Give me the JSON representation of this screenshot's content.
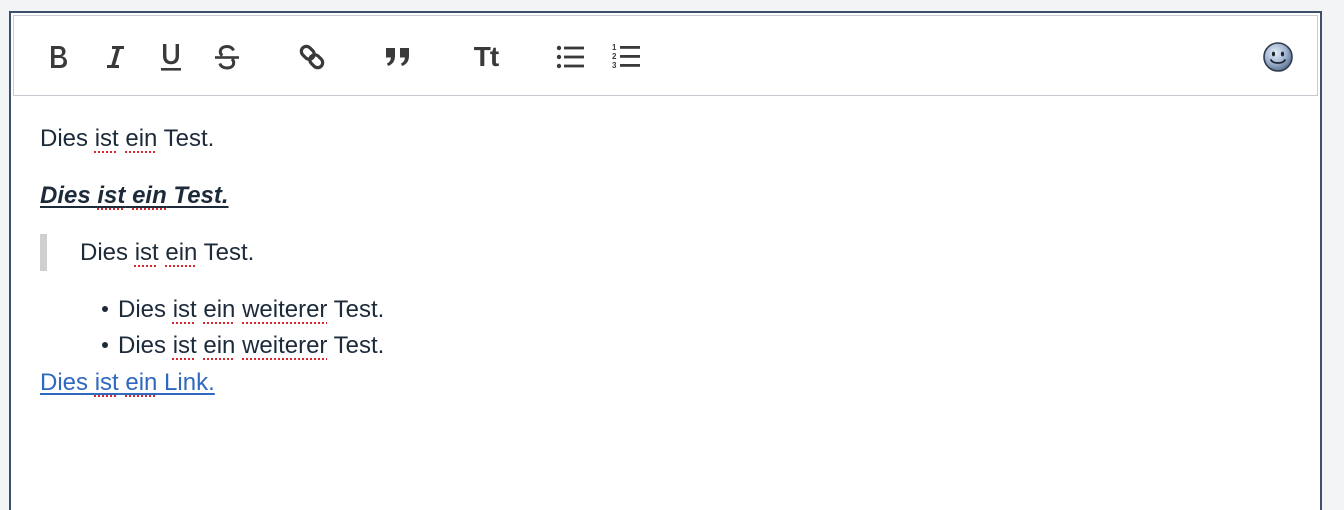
{
  "toolbar": {
    "buttons": [
      {
        "name": "bold",
        "icon": "bold-icon"
      },
      {
        "name": "italic",
        "icon": "italic-icon"
      },
      {
        "name": "underline",
        "icon": "underline-icon"
      },
      {
        "name": "strikethrough",
        "icon": "strikethrough-icon"
      },
      {
        "name": "link",
        "icon": "link-icon"
      },
      {
        "name": "quote",
        "icon": "quote-icon"
      },
      {
        "name": "font-size",
        "icon": "text-size-icon",
        "label": "Tt"
      },
      {
        "name": "bulleted-list",
        "icon": "bullet-list-icon"
      },
      {
        "name": "numbered-list",
        "icon": "numbered-list-icon"
      },
      {
        "name": "emoji",
        "icon": "smiley-icon"
      }
    ]
  },
  "content": {
    "para1": [
      "Dies ",
      "ist",
      " ",
      "ein",
      " Test."
    ],
    "para2": [
      "Dies ",
      "ist",
      " ",
      "ein",
      " Test."
    ],
    "quote": [
      "Dies ",
      "ist",
      " ",
      "ein",
      " Test."
    ],
    "list_items": [
      [
        "Dies ",
        "ist",
        " ",
        "ein",
        " ",
        "weiterer",
        " Test."
      ],
      [
        "Dies ",
        "ist",
        " ",
        "ein",
        " ",
        "weiterer",
        " Test."
      ]
    ],
    "link": [
      "Dies ",
      "ist",
      " ",
      "ein",
      " Link."
    ]
  },
  "colors": {
    "text": "#1c2a3a",
    "link": "#2e68c0",
    "spellcheck": "#d9272e",
    "border": "#3f4f6b"
  }
}
